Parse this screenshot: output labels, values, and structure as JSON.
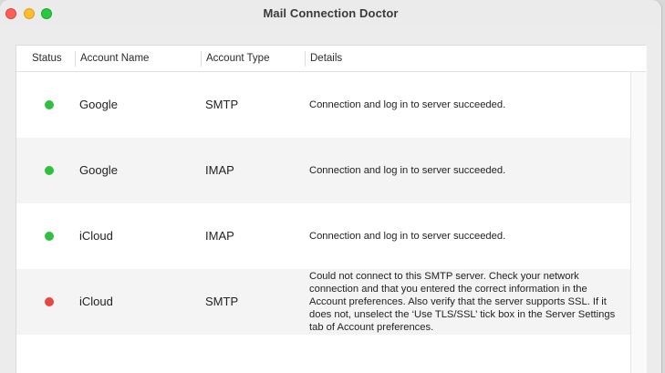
{
  "window": {
    "title": "Mail Connection Doctor"
  },
  "table": {
    "headers": {
      "status": "Status",
      "account_name": "Account Name",
      "account_type": "Account Type",
      "details": "Details"
    },
    "rows": [
      {
        "status": "ok",
        "status_color": "#2ec13f",
        "name": "Google",
        "type": "SMTP",
        "details": "Connection and log in to server succeeded."
      },
      {
        "status": "ok",
        "status_color": "#2ec13f",
        "name": "Google",
        "type": "IMAP",
        "details": "Connection and log in to server succeeded."
      },
      {
        "status": "ok",
        "status_color": "#2ec13f",
        "name": "iCloud",
        "type": "IMAP",
        "details": "Connection and log in to server succeeded."
      },
      {
        "status": "error",
        "status_color": "#e8463f",
        "name": "iCloud",
        "type": "SMTP",
        "details": "Could not connect to this SMTP server. Check your network connection and that you entered the correct information in the Account preferences. Also verify that the server supports SSL. If it does not, unselect the ‘Use TLS/SSL’ tick box in the Server Settings tab of Account preferences."
      }
    ]
  }
}
